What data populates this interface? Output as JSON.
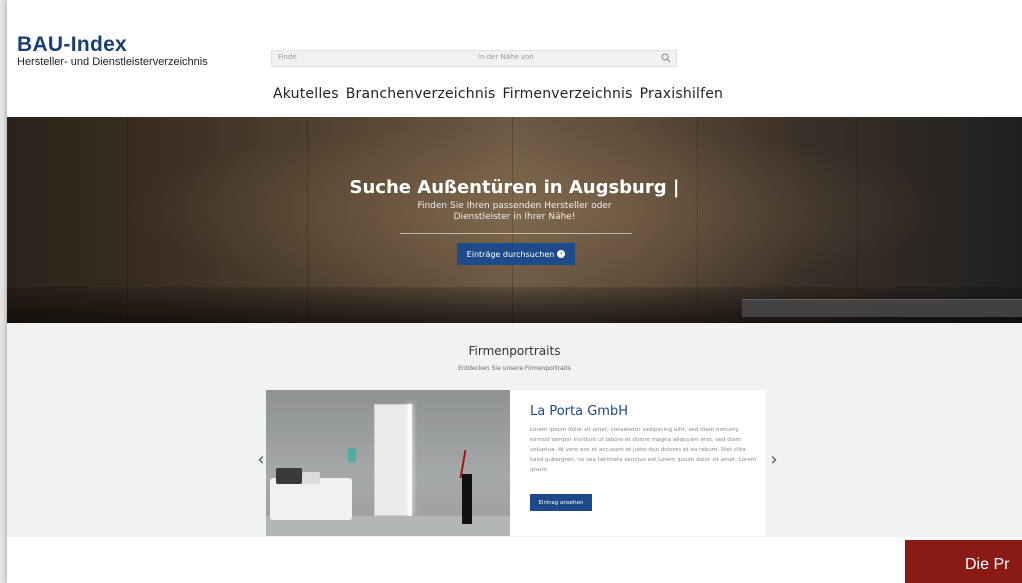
{
  "header": {
    "logo_title": "BAU-Index",
    "logo_subtitle": "Hersteller- und Dienstleisterverzeichnis"
  },
  "search": {
    "what_placeholder": "Finde",
    "where_placeholder": "in der Nähe von"
  },
  "nav": {
    "items": [
      {
        "label": "Akutelles"
      },
      {
        "label": "Branchenverzeichnis"
      },
      {
        "label": "Firmenverzeichnis"
      },
      {
        "label": "Praxishilfen"
      }
    ]
  },
  "hero": {
    "title": "Suche Außentüren in Augsburg |",
    "subtitle_line1": "Finden Sie Ihren passenden Hersteller oder",
    "subtitle_line2": "Dienstleister in Ihrer Nähe!",
    "button_label": "Einträge durchsuchen"
  },
  "portraits": {
    "title": "Firmenportraits",
    "subtitle": "Entdecken Sie unsere Firmenportraits",
    "card": {
      "company": "La Porta GmbH",
      "text": "Lorem ipsum dolor sit amet, consetetur sadipscing elitr, sed diam nonumy eirmod tempor invidunt ut labore et dolore magna aliquyam erat, sed diam voluptua. At vero eos et accusam et justo duo dolores et ea rebum. Stet clita kasd gubergren, no sea takimata sanctus est Lorem ipsum dolor sit amet. Lorem ipsum",
      "button_label": "Eintrag ansehen"
    },
    "prev_arrow": "‹",
    "next_arrow": "›"
  },
  "banner": {
    "text": "Die Pr"
  },
  "colors": {
    "brand_blue": "#1c4a8a",
    "logo_blue": "#1a3d73",
    "banner_red": "#8a1a14"
  }
}
